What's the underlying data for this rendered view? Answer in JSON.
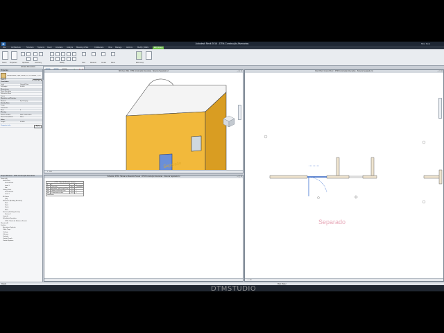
{
  "app": {
    "title_prefix": "Autodesk Revit 2016 -",
    "title": "DTM-Construção Alvenarias",
    "user": "Misc Reis"
  },
  "tabs": [
    "File",
    "Architecture",
    "Structure",
    "Systems",
    "Insert",
    "Annotate",
    "Analyze",
    "Massing & Site",
    "Collaborate",
    "View",
    "Manage",
    "Add-Ins",
    "Modify | Walls",
    "Edit Group"
  ],
  "ribbon_groups": [
    "Select",
    "Properties",
    "Clipboard",
    "Geometry",
    "Modify",
    "View",
    "Measure",
    "Create",
    "Mode",
    "Edit Group"
  ],
  "options_label": "Activate Dimensions",
  "edit_group": {
    "buttons": [
      "Add",
      "Remove",
      "Attach",
      "Finish",
      "Cancel"
    ],
    "panel_label": "Edit Group"
  },
  "properties": {
    "header": "Properties",
    "type_name": "Wall_Alvenaria_Tijolo_Furado_15_Cm_Reboco_2_Cm",
    "selector": "Walls (1)",
    "edit_type": "Edit Type",
    "rows": [
      {
        "label": "Constraints",
        "value": "",
        "section": true
      },
      {
        "label": "Level",
        "value": "Ground Floor"
      },
      {
        "label": "Sill Height",
        "value": "0.0000"
      },
      {
        "label": "Dimensions",
        "value": "",
        "section": true
      },
      {
        "label": "Room Bounding",
        "value": ""
      },
      {
        "label": "Related to Mass",
        "value": ""
      },
      {
        "label": "Frame",
        "value": ""
      },
      {
        "label": "Materials and Finishes",
        "value": "",
        "section": true
      },
      {
        "label": "Material",
        "value": "By Category"
      },
      {
        "label": "Identity Data",
        "value": "",
        "section": true
      },
      {
        "label": "Image",
        "value": ""
      },
      {
        "label": "Comments",
        "value": ""
      },
      {
        "label": "Mark",
        "value": "0"
      },
      {
        "label": "Phasing",
        "value": "",
        "section": true
      },
      {
        "label": "Phase Created",
        "value": "New Construction"
      },
      {
        "label": "Phase Demolished",
        "value": "None"
      },
      {
        "label": "Other",
        "value": "",
        "section": true
      },
      {
        "label": "Length",
        "value": "0.3400"
      }
    ],
    "help_link": "Properties help",
    "apply": "Apply"
  },
  "browser": {
    "header": "Project Browser - DTM-Construção Alvenarias",
    "items": [
      "Views (all)",
      "Floor Plans",
      "Ground Floor",
      "Level 1",
      "Site",
      "Ceiling Plans",
      "Ground Floor",
      "Level 1",
      "3D Views",
      "{3D}",
      "Elevations (Building Elevation)",
      "East",
      "North",
      "South",
      "West",
      "Sections (Building Section)",
      "Section 1",
      "Legends",
      "Schedules/Quantities",
      "DTM - Tabela de Materiais Parede",
      "Sheets (all)",
      "Families",
      "Annotation Symbols",
      "Cable Trays",
      "Ceilings",
      "Columns",
      "Conduits",
      "Curtain Panels",
      "Curtain Systems"
    ]
  },
  "view3d": {
    "title": "3D View: {3D} - DTM-Construção Alvenarias - Sistema Separado.rvt",
    "scale": "1 : 100",
    "label": "Separado"
  },
  "schedule": {
    "title": "Schedule: DTM - Tabela de Materiais Parede - DTM-Construção Alvenarias - Sistema Separado.rvt",
    "table_title": "<DTM - Tabela de Materiais Parede>",
    "col_letters": [
      "A",
      "B",
      "C",
      "D"
    ],
    "headers": [
      "Nº",
      "Descrição",
      "Área",
      "Quantidade"
    ],
    "rows": [
      [
        "001",
        "Alvenaria Tijolo Furado 15cm",
        "23.57",
        "1"
      ],
      [
        "002",
        "Reboco de cimento 2cm",
        "23.57",
        "2"
      ],
      [
        "003",
        "Pintura latex acrílica",
        "23.57",
        "2"
      ]
    ],
    "total_label": "Grand total"
  },
  "plan": {
    "title": "Floor Plan: Ground Floor - DTM-Construção Alvenarias - Sistema Separado.rvt",
    "scale": "1 : 50",
    "label": "Separado"
  },
  "status": {
    "text": "Ready",
    "model": "Main Model"
  },
  "watermark": "DTMSTUDIO",
  "colors": {
    "wall": "#f2b93b",
    "door": "#6a8fd8",
    "accent_tab": "#6fbf4a"
  }
}
